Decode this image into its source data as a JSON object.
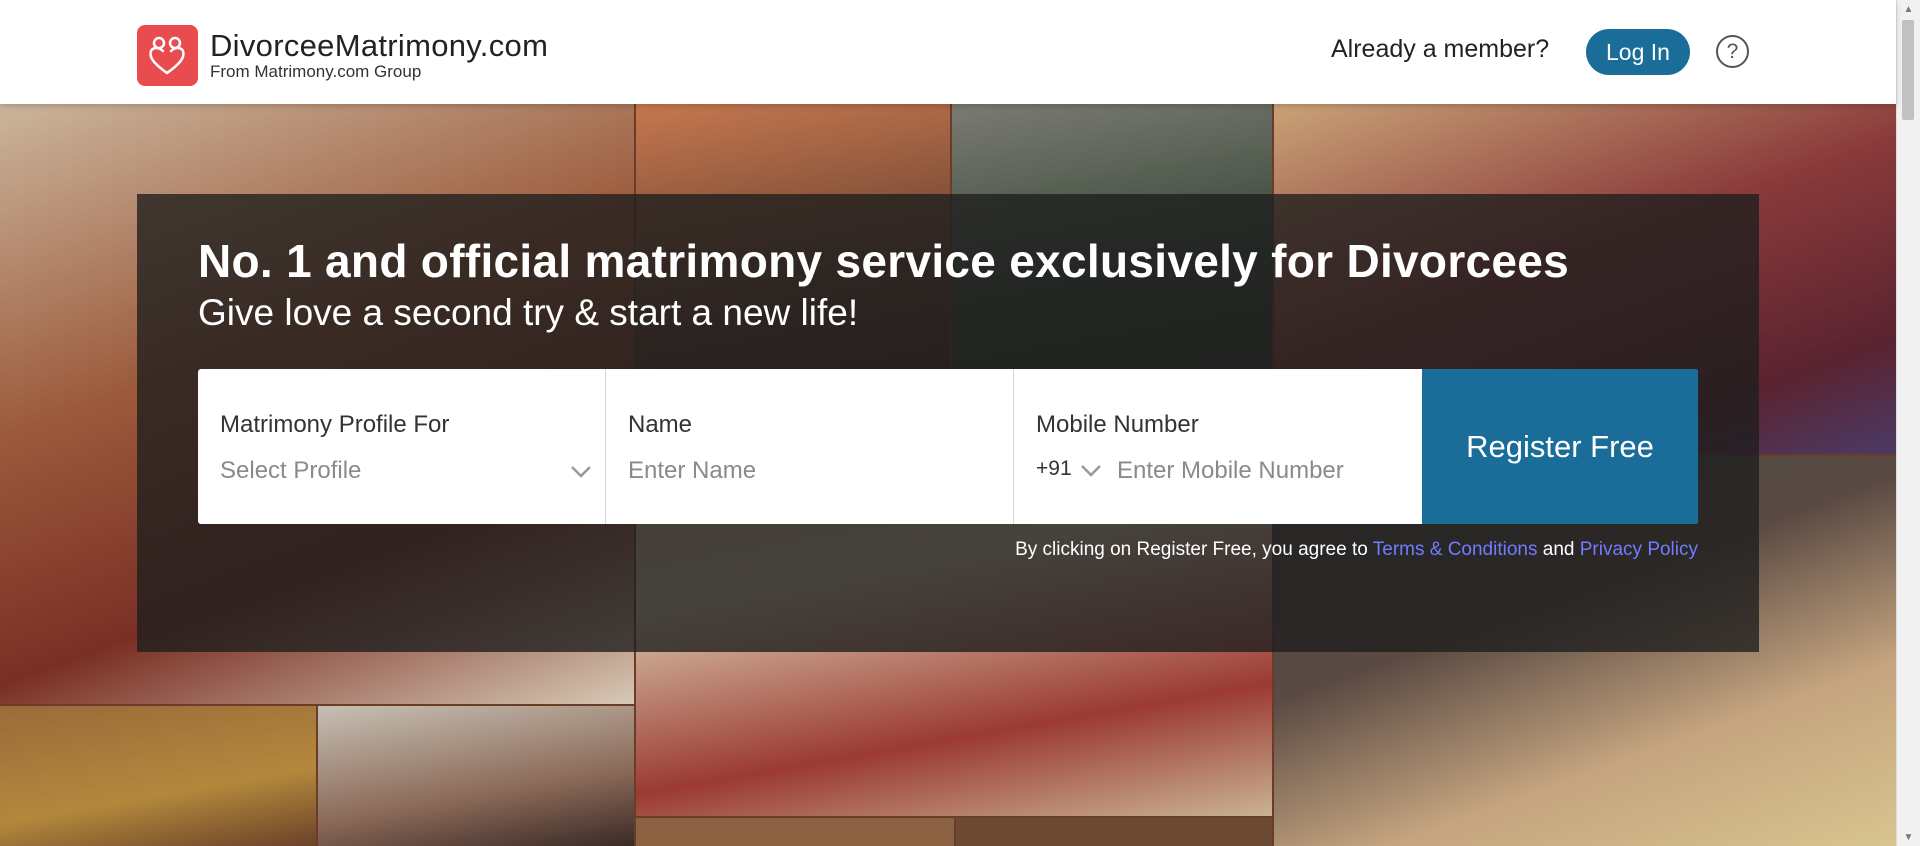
{
  "header": {
    "brand": "DivorceeMatrimony.com",
    "brand_sub": "From Matrimony.com Group",
    "already_member": "Already a member?",
    "login_label": "Log In",
    "help_glyph": "?"
  },
  "hero": {
    "headline": "No. 1 and official matrimony service exclusively for Divorcees",
    "subline": "Give love a second try & start a new life!"
  },
  "form": {
    "profile_label": "Matrimony Profile For",
    "profile_placeholder": "Select Profile",
    "name_label": "Name",
    "name_placeholder": "Enter Name",
    "mobile_label": "Mobile Number",
    "country_code": "+91",
    "mobile_placeholder": "Enter Mobile Number",
    "register_label": "Register Free"
  },
  "terms": {
    "prefix": "By clicking on Register Free, you agree to ",
    "terms_link": "Terms & Conditions",
    "conjunction": " and ",
    "privacy_link": "Privacy Policy"
  },
  "colors": {
    "brand_red": "#e84c4f",
    "primary_blue": "#1a6d99",
    "link_blue": "#6f7cff"
  }
}
